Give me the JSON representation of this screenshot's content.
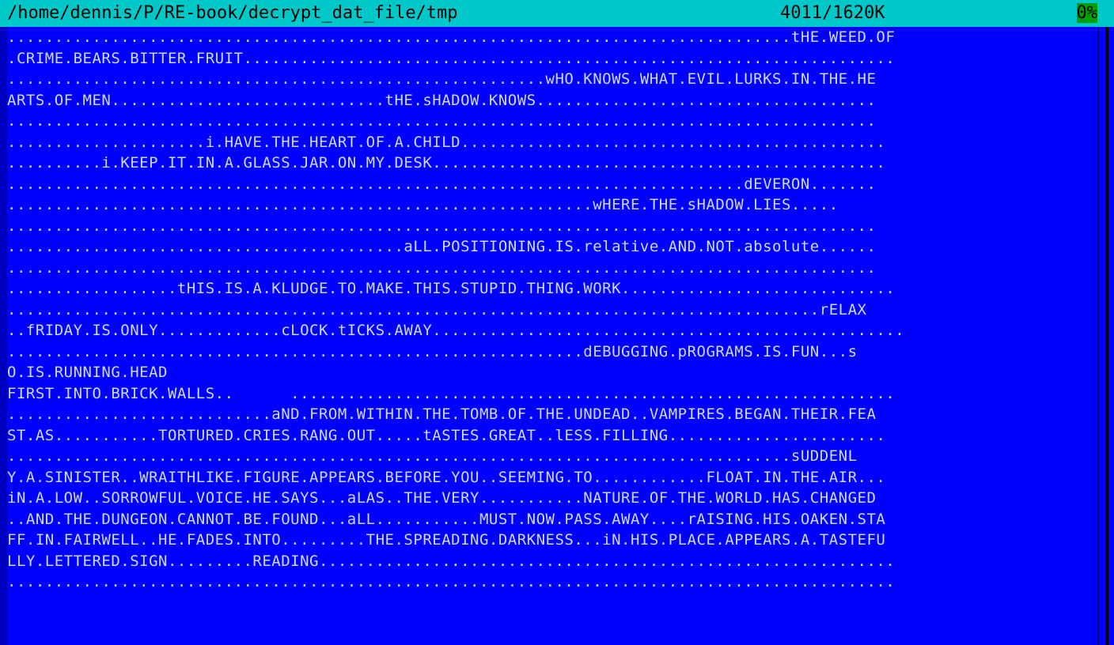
{
  "titlebar": {
    "path": "/home/dennis/P/RE-book/decrypt_dat_file/tmp",
    "position": "4011/1620K",
    "percent": "0%"
  },
  "lines": [
    "...................................................................................tHE.WEED.OF",
    ".CRIME.BEARS.BITTER.FRUIT.....................................................................",
    ".........................................................wHO.KNOWS.WHAT.EVIL.LURKS.IN.THE.HE",
    "ARTS.OF.MEN.............................tHE.sHADOW.KNOWS....................................",
    "............................................................................................",
    ".....................i.HAVE.THE.HEART.OF.A.CHILD.............................................",
    "..........i.KEEP.IT.IN.A.GLASS.JAR.ON.MY.DESK................................................",
    "..............................................................................dEVERON.......",
    "..............................................................wHERE.THE.sHADOW.LIES.....",
    "............................................................................................",
    "..........................................aLL.POSITIONING.IS.relative.AND.NOT.absolute......",
    "............................................................................................",
    "..................tHIS.IS.A.KLUDGE.TO.MAKE.THIS.STUPID.THING.WORK.............................",
    "......................................................................................rELAX",
    "..fRIDAY.IS.ONLY.............cLOCK.tICKS.AWAY..................................................",
    ".............................................................dEBUGGING.pROGRAMS.IS.FUN...s",
    "O.IS.RUNNING.HEAD",
    "FIRST.INTO.BRICK.WALLS..      ................................................................",
    "............................aND.FROM.WITHIN.THE.TOMB.OF.THE.UNDEAD..VAMPIRES.BEGAN.THEIR.FEA",
    "ST.AS...........TORTURED.CRIES.RANG.OUT.....tASTES.GREAT..lESS.FILLING.......................",
    "...................................................................................sUDDENL",
    "Y.A.SINISTER..WRAITHLIKE.FIGURE.APPEARS.BEFORE.YOU..SEEMING.TO............FLOAT.IN.THE.AIR...",
    "iN.A.LOW..SORROWFUL.VOICE.HE.SAYS...aLAS..THE.VERY...........NATURE.OF.THE.WORLD.HAS.CHANGED",
    "..AND.THE.DUNGEON.CANNOT.BE.FOUND...aLL...........MUST.NOW.PASS.AWAY....rAISING.HIS.OAKEN.STA",
    "FF.IN.FAIRWELL..HE.FADES.INTO.........THE.SPREADING.DARKNESS...iN.HIS.PLACE.APPEARS.A.TASTEFU",
    "LLY.LETTERED.SIGN.........READING.............................................................",
    ".............................................................................................."
  ],
  "colors": {
    "background": "#0000ff",
    "titlebar": "#00c8c8",
    "text": "#d0d8ff",
    "percent_badge": "#00a000"
  }
}
